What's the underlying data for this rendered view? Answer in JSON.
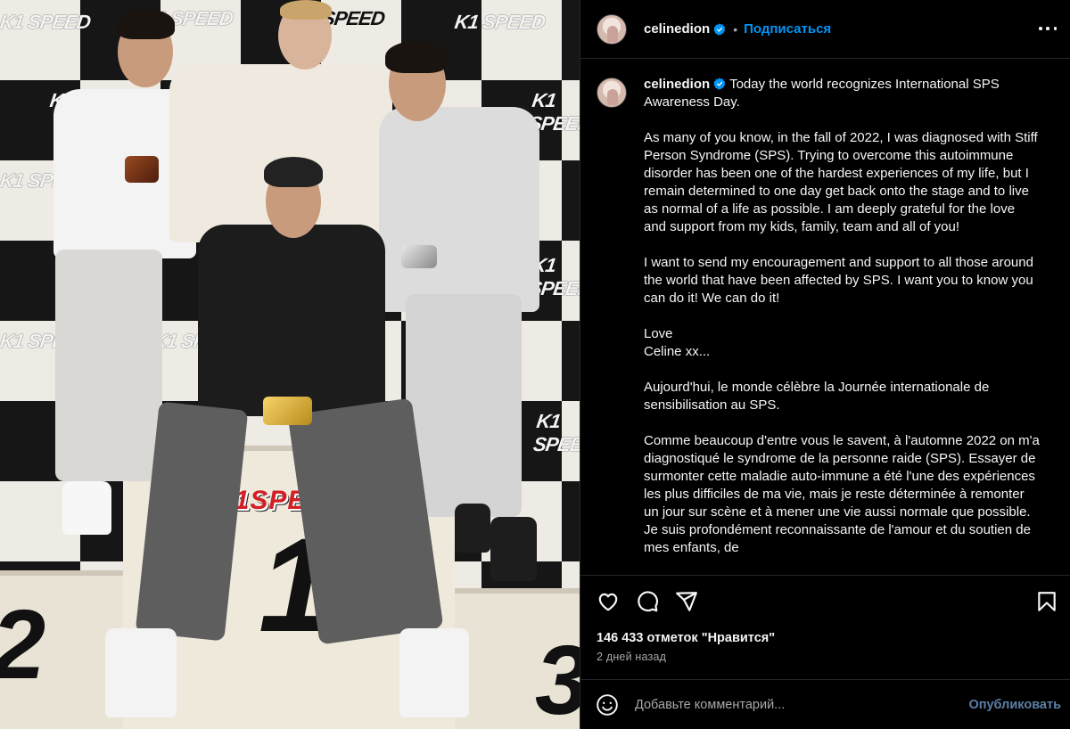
{
  "photo": {
    "brand_text": "K1 SPEED",
    "podium_logo": "K1SPEED",
    "podium_numbers": [
      "1",
      "2",
      "3"
    ],
    "brand_colors": {
      "red": "#d21f26",
      "checker_dark": "#161616",
      "checker_light": "#eeeae4"
    }
  },
  "post": {
    "username": "celinedion",
    "verified": true,
    "follow_label": "Подписаться",
    "more_icon": "ellipsis-icon"
  },
  "caption": {
    "username": "celinedion",
    "text": " Today the world recognizes International SPS Awareness Day.\n\nAs many of you know, in the fall of 2022, I was diagnosed with Stiff Person Syndrome (SPS). Trying to overcome this autoimmune disorder has been one of the hardest experiences of my life, but I remain determined to one day get back onto the stage and to live as normal of a life as possible. I am deeply grateful for the love and support from my kids, family, team and all of you!\n\nI want to send my encouragement and support to all those around the world that have been affected by SPS. I want you to know you can do it! We can do it!\n\nLove\nCeline xx...\n\nAujourd'hui, le monde célèbre la Journée internationale de sensibilisation au SPS.\n\nComme beaucoup d'entre vous le savent, à l'automne 2022 on m'a diagnostiqué le syndrome de la personne raide (SPS). Essayer de surmonter cette maladie auto-immune a été l'une des expériences les plus difficiles de ma vie, mais je reste déterminée à remonter un jour sur scène et à mener une vie aussi normale que possible. Je suis profondément reconnaissante de l'amour et du soutien de mes enfants, de"
  },
  "actions": {
    "icons": [
      "heart-icon",
      "comment-icon",
      "share-icon",
      "bookmark-icon"
    ]
  },
  "likes_text": "146 433 отметок \"Нравится\"",
  "time_text": "2 дней назад",
  "comment": {
    "placeholder": "Добавьте комментарий...",
    "publish_label": "Опубликовать"
  },
  "colors": {
    "background": "#000000",
    "text": "#f5f5f5",
    "secondary_text": "#a8a8a8",
    "link_blue": "#0095f6",
    "publish_disabled": "#5c7fa6",
    "border": "#262626"
  }
}
